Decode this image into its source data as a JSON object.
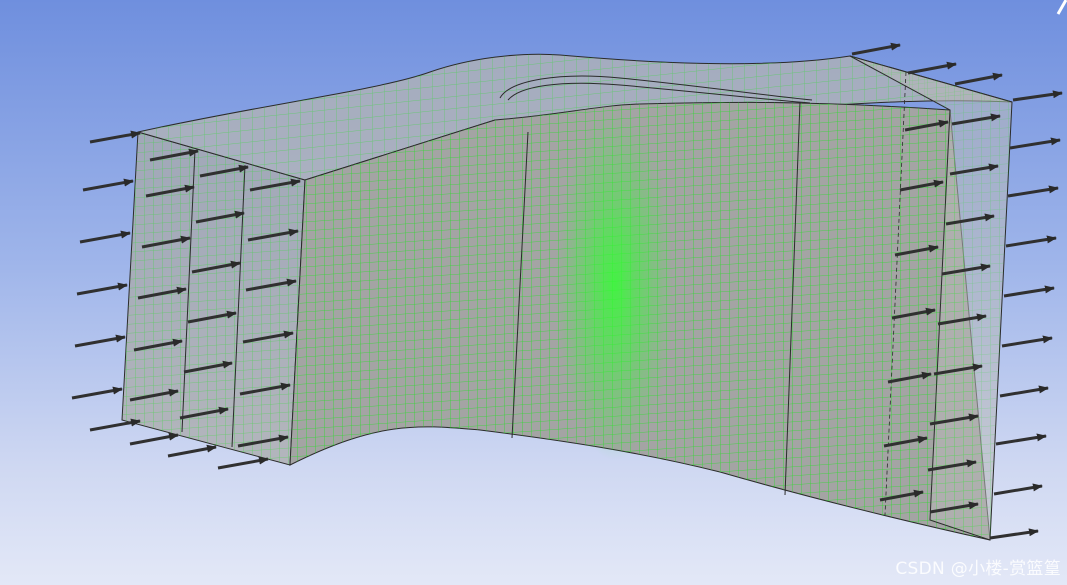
{
  "viewport": {
    "background_top": "#6f8fde",
    "background_bottom": "#e3e8f7",
    "mesh_color": "#22e022",
    "body_color": "#a9a9a9",
    "edge_color": "#2b2b2b",
    "arrow_color": "#303030"
  },
  "watermark": {
    "text": "CSDN @小楼-赏篮篁"
  },
  "icons": {
    "flow_arrow": "arrow-right-icon",
    "triad": "axis-triad-icon"
  }
}
